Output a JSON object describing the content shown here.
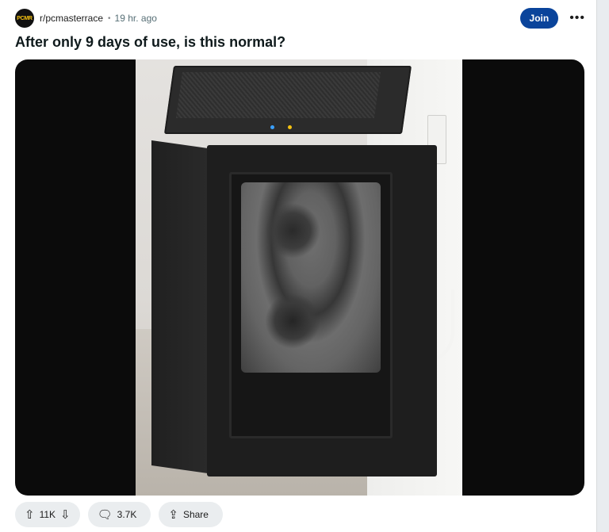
{
  "post": {
    "avatar_text": "PCMR",
    "subreddit": "r/pcmasterrace",
    "separator": "•",
    "time": "19 hr. ago",
    "join_label": "Join",
    "more_label": "•••",
    "title": "After only 9 days of use, is this normal?"
  },
  "actions": {
    "votes": "11K",
    "comments": "3.7K",
    "share_label": "Share"
  },
  "icons": {
    "upvote": "upvote-icon",
    "downvote": "downvote-icon",
    "comment": "comment-icon",
    "share": "share-icon"
  },
  "colors": {
    "join_button": "#0a449b",
    "pill_bg": "#eaedef"
  }
}
